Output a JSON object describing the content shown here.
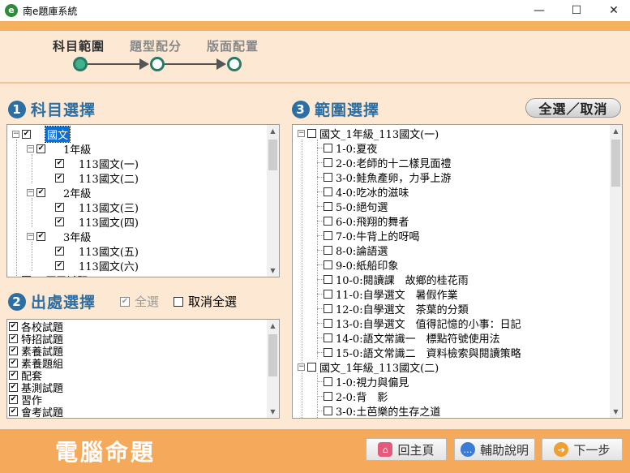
{
  "window": {
    "title": "南e題庫系統",
    "app_icon_glyph": "e",
    "min": "—",
    "max": "☐",
    "close": "✕"
  },
  "steps": [
    "科目範圍",
    "題型配分",
    "版面配置"
  ],
  "sections": {
    "subject": {
      "num": "1",
      "title": "科目選擇"
    },
    "source": {
      "num": "2",
      "title": "出處選擇",
      "select_all": "全選",
      "deselect_all": "取消全選"
    },
    "range": {
      "num": "3",
      "title": "範圍選擇",
      "toggle_button": "全選／取消"
    }
  },
  "subject_tree": [
    {
      "label": "國文",
      "checked": true,
      "expander": "⊟",
      "level": 0,
      "selected": true
    },
    {
      "label": "1年級",
      "checked": true,
      "expander": "⊟",
      "level": 1
    },
    {
      "label": "113國文(一)",
      "checked": true,
      "level": 2
    },
    {
      "label": "113國文(二)",
      "checked": true,
      "level": 2
    },
    {
      "label": "2年級",
      "checked": true,
      "expander": "⊟",
      "level": 1
    },
    {
      "label": "113國文(三)",
      "checked": true,
      "level": 2
    },
    {
      "label": "113國文(四)",
      "checked": true,
      "level": 2
    },
    {
      "label": "3年級",
      "checked": true,
      "expander": "⊟",
      "level": 1
    },
    {
      "label": "113國文(五)",
      "checked": true,
      "level": 2
    },
    {
      "label": "113國文(六)",
      "checked": true,
      "level": 2
    },
    {
      "label": "歷屆試題",
      "checked": false,
      "expander": "⊞",
      "level": 0
    }
  ],
  "source_list": [
    {
      "label": "各校試題",
      "checked": true
    },
    {
      "label": "特招試題",
      "checked": true
    },
    {
      "label": "素養試題",
      "checked": true
    },
    {
      "label": "素養題組",
      "checked": true
    },
    {
      "label": "配套",
      "checked": true
    },
    {
      "label": "基測試題",
      "checked": true
    },
    {
      "label": "習作",
      "checked": true
    },
    {
      "label": "會考試題",
      "checked": true
    }
  ],
  "range_tree": [
    {
      "label": "國文_1年級_113國文(一)",
      "level": 0
    },
    {
      "label": "1-0:夏夜",
      "level": 1
    },
    {
      "label": "2-0:老師的十二樣見面禮",
      "level": 1
    },
    {
      "label": "3-0:鮭魚產卵，力爭上游",
      "level": 1
    },
    {
      "label": "4-0:吃冰的滋味",
      "level": 1
    },
    {
      "label": "5-0:絕句選",
      "level": 1
    },
    {
      "label": "6-0:飛翔的舞者",
      "level": 1
    },
    {
      "label": "7-0:牛背上的呀喝",
      "level": 1
    },
    {
      "label": "8-0:論語選",
      "level": 1
    },
    {
      "label": "9-0:紙船印象",
      "level": 1
    },
    {
      "label": "10-0:閱讀課　故鄉的桂花雨",
      "level": 1
    },
    {
      "label": "11-0:自學選文　暑假作業",
      "level": 1
    },
    {
      "label": "12-0:自學選文　茶葉的分類",
      "level": 1
    },
    {
      "label": "13-0:自學選文　值得記憶的小事：日記",
      "level": 1
    },
    {
      "label": "14-0:語文常識一　標點符號使用法",
      "level": 1
    },
    {
      "label": "15-0:語文常識二　資料檢索與閱讀策略",
      "level": 1
    },
    {
      "label": "國文_1年級_113國文(二)",
      "level": 0
    },
    {
      "label": "1-0:視力與偏見",
      "level": 1
    },
    {
      "label": "2-0:背　影",
      "level": 1
    },
    {
      "label": "3-0:土芭樂的生存之道",
      "level": 1
    }
  ],
  "footer": {
    "title": "電腦命題",
    "home": "回主頁",
    "help": "輔助說明",
    "next": "下一步"
  },
  "colors": {
    "accent": "#2d6fa3",
    "orange": "#f5a95a",
    "bg": "#fde9d3",
    "selection": "#0f6fd0"
  }
}
